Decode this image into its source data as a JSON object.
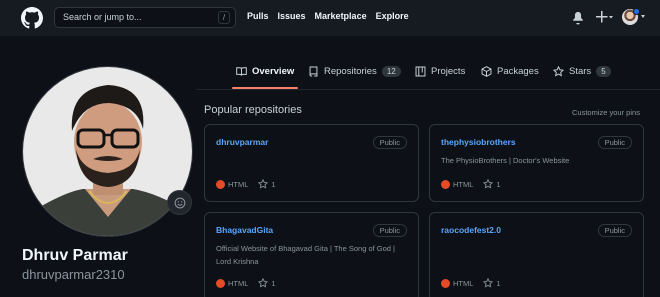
{
  "header": {
    "search_placeholder": "Search or jump to...",
    "search_key": "/",
    "nav": [
      "Pulls",
      "Issues",
      "Marketplace",
      "Explore"
    ]
  },
  "tabs": [
    {
      "label": "Overview",
      "icon": "book-icon",
      "active": true
    },
    {
      "label": "Repositories",
      "icon": "repo-icon",
      "count": "12"
    },
    {
      "label": "Projects",
      "icon": "project-icon"
    },
    {
      "label": "Packages",
      "icon": "package-icon"
    },
    {
      "label": "Stars",
      "icon": "star-icon",
      "count": "5"
    }
  ],
  "profile": {
    "name": "Dhruv Parmar",
    "login": "dhruvparmar2310"
  },
  "repos_section": {
    "title": "Popular repositories",
    "customize": "Customize your pins"
  },
  "repos": [
    {
      "name": "dhruvparmar",
      "visibility": "Public",
      "description": "",
      "language": "HTML",
      "stars": "1"
    },
    {
      "name": "thephysiobrothers",
      "visibility": "Public",
      "description": "The PhysioBrothers | Doctor's Website",
      "language": "HTML",
      "stars": "1"
    },
    {
      "name": "BhagavadGita",
      "visibility": "Public",
      "description": "Official Website of Bhagavad Gita | The Song of God | Lord Krishna",
      "language": "HTML",
      "stars": "1"
    },
    {
      "name": "raocodefest2.0",
      "visibility": "Public",
      "description": "",
      "language": "HTML",
      "stars": "1"
    }
  ],
  "colors": {
    "html_language": "#e34c26",
    "link": "#58a6ff",
    "active_tab_underline": "#f78166",
    "background": "#0d1117",
    "header": "#161b22"
  }
}
